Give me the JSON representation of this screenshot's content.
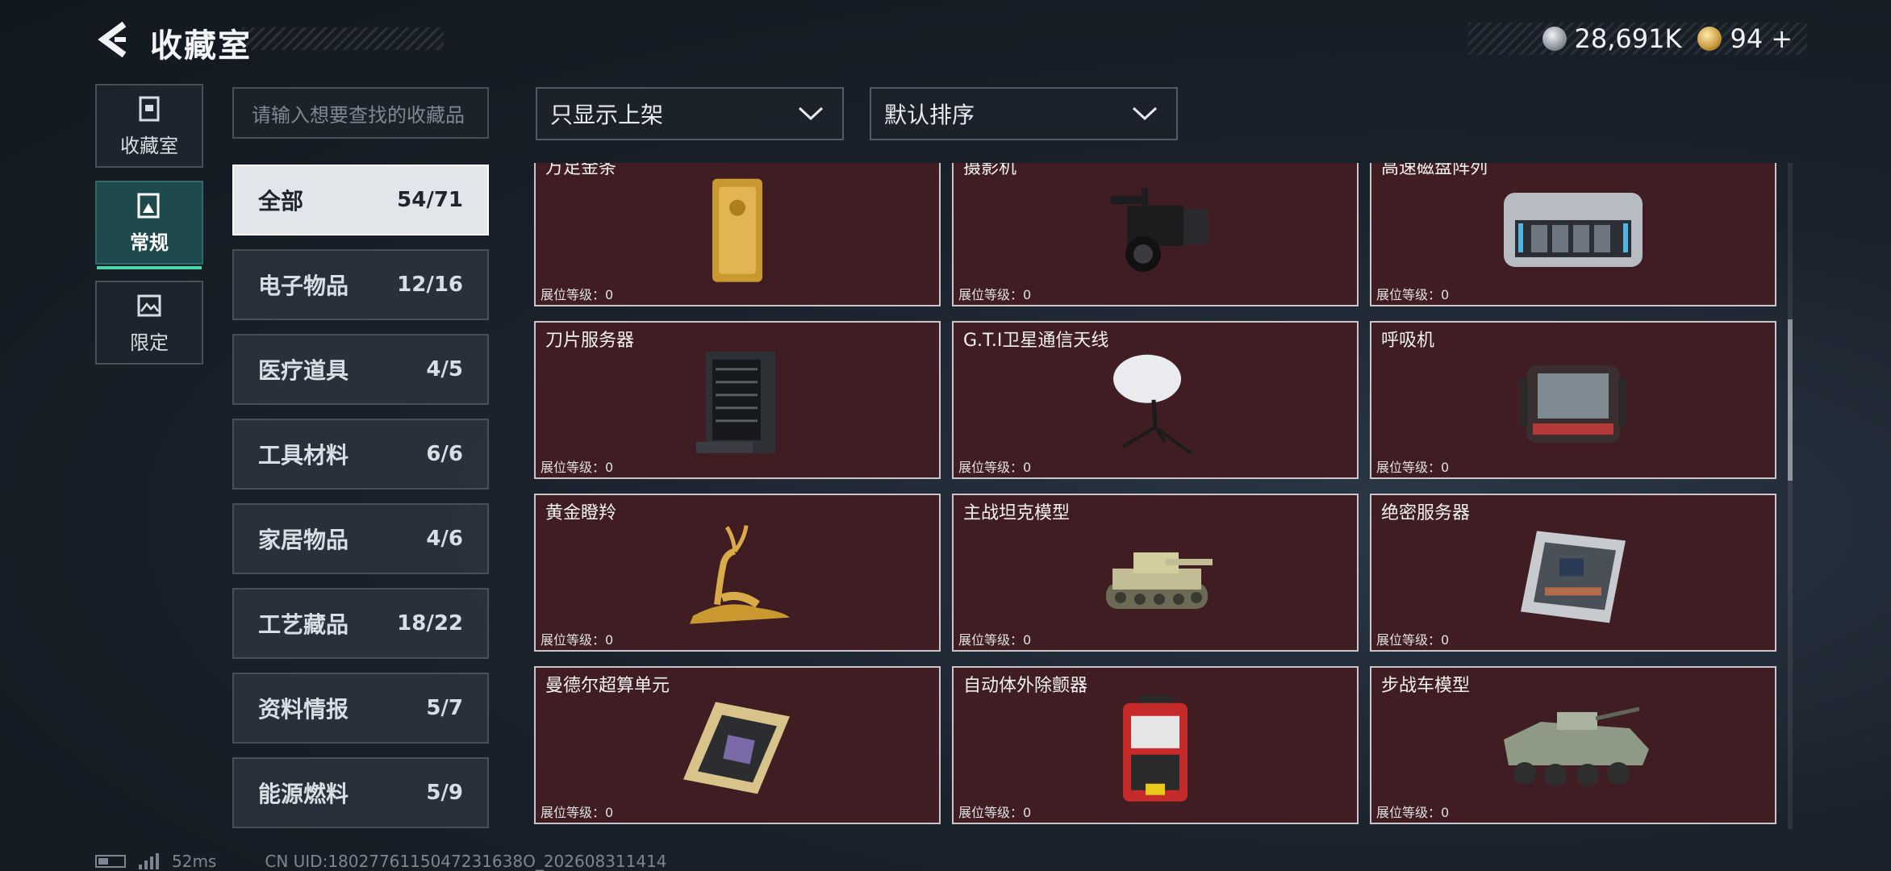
{
  "header": {
    "title": "收藏室",
    "silver_amount": "28,691K",
    "gold_amount": "94",
    "gold_plus": "+"
  },
  "mode_tabs": [
    {
      "label": "收藏室",
      "active": false
    },
    {
      "label": "常规",
      "active": true
    },
    {
      "label": "限定",
      "active": false
    }
  ],
  "search": {
    "placeholder": "请输入想要查找的收藏品"
  },
  "categories": [
    {
      "name": "全部",
      "count": "54/71",
      "active": true
    },
    {
      "name": "电子物品",
      "count": "12/16"
    },
    {
      "name": "医疗道具",
      "count": "4/5"
    },
    {
      "name": "工具材料",
      "count": "6/6"
    },
    {
      "name": "家居物品",
      "count": "4/6"
    },
    {
      "name": "工艺藏品",
      "count": "18/22"
    },
    {
      "name": "资料情报",
      "count": "5/7"
    },
    {
      "name": "能源燃料",
      "count": "5/9"
    }
  ],
  "filters": {
    "shelf_filter": "只显示上架",
    "sort": "默认排序"
  },
  "items": [
    {
      "name": "万足金条",
      "level_label": "展位等级：0",
      "icon": "gold-bar-icon"
    },
    {
      "name": "摄影机",
      "level_label": "展位等级：0",
      "icon": "camera-icon"
    },
    {
      "name": "高速磁盘阵列",
      "level_label": "展位等级：0",
      "icon": "disk-array-icon"
    },
    {
      "name": "刀片服务器",
      "level_label": "展位等级：0",
      "icon": "blade-server-icon"
    },
    {
      "name": "G.T.I卫星通信天线",
      "level_label": "展位等级：0",
      "icon": "satellite-dish-icon"
    },
    {
      "name": "呼吸机",
      "level_label": "展位等级：0",
      "icon": "ventilator-icon"
    },
    {
      "name": "黄金瞪羚",
      "level_label": "展位等级：0",
      "icon": "golden-gazelle-icon"
    },
    {
      "name": "主战坦克模型",
      "level_label": "展位等级：0",
      "icon": "tank-model-icon"
    },
    {
      "name": "绝密服务器",
      "level_label": "展位等级：0",
      "icon": "secret-server-icon"
    },
    {
      "name": "曼德尔超算单元",
      "level_label": "展位等级：0",
      "icon": "supercomputer-unit-icon"
    },
    {
      "name": "自动体外除颤器",
      "level_label": "展位等级：0",
      "icon": "defibrillator-icon"
    },
    {
      "name": "步战车模型",
      "level_label": "展位等级：0",
      "icon": "ifv-model-icon"
    }
  ],
  "footer": {
    "ping": "52ms",
    "uid": "CN UID:1802776115047231638O_202608311414"
  },
  "colors": {
    "card_bg": "#3f1d22",
    "active_tab_accent": "#46d6a8"
  }
}
